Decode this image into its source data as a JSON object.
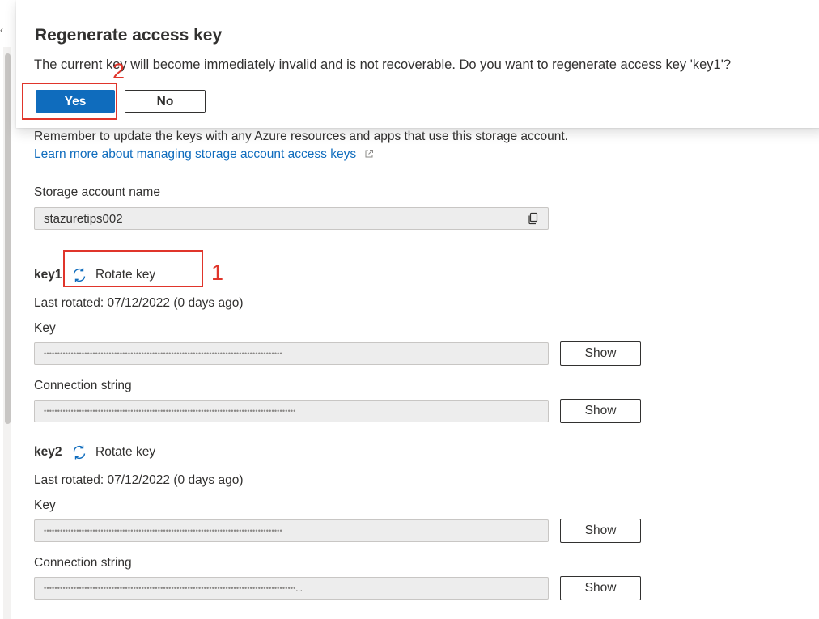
{
  "dialog": {
    "title": "Regenerate access key",
    "message": "The current key will become immediately invalid and is not recoverable. Do you want to regenerate access key 'key1'?",
    "yes_label": "Yes",
    "no_label": "No"
  },
  "info": {
    "text": "Remember to update the keys with any Azure resources and apps that use this storage account.",
    "link_text": "Learn more about managing storage account access keys"
  },
  "storage": {
    "label": "Storage account name",
    "value": "stazuretips002"
  },
  "keys": [
    {
      "name": "key1",
      "rotate_label": "Rotate key",
      "last_rotated": "Last rotated: 07/12/2022 (0 days ago)",
      "key_label": "Key",
      "key_masked": "••••••••••••••••••••••••••••••••••••••••••••••••••••••••••••••••••••••••••••••••••••••••",
      "conn_label": "Connection string",
      "conn_masked": "•••••••••••••••••••••••••••••••••••••••••••••••••••••••••••••••••••••••••••••••••••••••••••••",
      "show_label": "Show"
    },
    {
      "name": "key2",
      "rotate_label": "Rotate key",
      "last_rotated": "Last rotated: 07/12/2022 (0 days ago)",
      "key_label": "Key",
      "key_masked": "••••••••••••••••••••••••••••••••••••••••••••••••••••••••••••••••••••••••••••••••••••••••",
      "conn_label": "Connection string",
      "conn_masked": "•••••••••••••••••••••••••••••••••••••••••••••••••••••••••••••••••••••••••••••••••••••••••••••",
      "show_label": "Show"
    }
  ],
  "annotations": {
    "step1": "1",
    "step2": "2"
  },
  "colors": {
    "accent": "#0f6cbd",
    "annotation": "#e0352b"
  }
}
